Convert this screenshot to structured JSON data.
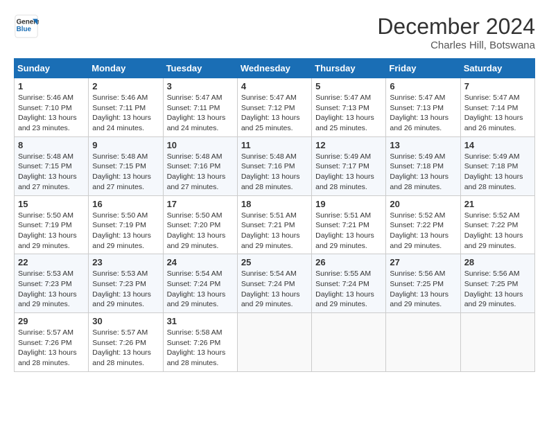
{
  "header": {
    "logo_line1": "General",
    "logo_line2": "Blue",
    "month": "December 2024",
    "location": "Charles Hill, Botswana"
  },
  "days_of_week": [
    "Sunday",
    "Monday",
    "Tuesday",
    "Wednesday",
    "Thursday",
    "Friday",
    "Saturday"
  ],
  "weeks": [
    [
      {
        "day": 1,
        "lines": [
          "Sunrise: 5:46 AM",
          "Sunset: 7:10 PM",
          "Daylight: 13 hours",
          "and 23 minutes."
        ]
      },
      {
        "day": 2,
        "lines": [
          "Sunrise: 5:46 AM",
          "Sunset: 7:11 PM",
          "Daylight: 13 hours",
          "and 24 minutes."
        ]
      },
      {
        "day": 3,
        "lines": [
          "Sunrise: 5:47 AM",
          "Sunset: 7:11 PM",
          "Daylight: 13 hours",
          "and 24 minutes."
        ]
      },
      {
        "day": 4,
        "lines": [
          "Sunrise: 5:47 AM",
          "Sunset: 7:12 PM",
          "Daylight: 13 hours",
          "and 25 minutes."
        ]
      },
      {
        "day": 5,
        "lines": [
          "Sunrise: 5:47 AM",
          "Sunset: 7:13 PM",
          "Daylight: 13 hours",
          "and 25 minutes."
        ]
      },
      {
        "day": 6,
        "lines": [
          "Sunrise: 5:47 AM",
          "Sunset: 7:13 PM",
          "Daylight: 13 hours",
          "and 26 minutes."
        ]
      },
      {
        "day": 7,
        "lines": [
          "Sunrise: 5:47 AM",
          "Sunset: 7:14 PM",
          "Daylight: 13 hours",
          "and 26 minutes."
        ]
      }
    ],
    [
      {
        "day": 8,
        "lines": [
          "Sunrise: 5:48 AM",
          "Sunset: 7:15 PM",
          "Daylight: 13 hours",
          "and 27 minutes."
        ]
      },
      {
        "day": 9,
        "lines": [
          "Sunrise: 5:48 AM",
          "Sunset: 7:15 PM",
          "Daylight: 13 hours",
          "and 27 minutes."
        ]
      },
      {
        "day": 10,
        "lines": [
          "Sunrise: 5:48 AM",
          "Sunset: 7:16 PM",
          "Daylight: 13 hours",
          "and 27 minutes."
        ]
      },
      {
        "day": 11,
        "lines": [
          "Sunrise: 5:48 AM",
          "Sunset: 7:16 PM",
          "Daylight: 13 hours",
          "and 28 minutes."
        ]
      },
      {
        "day": 12,
        "lines": [
          "Sunrise: 5:49 AM",
          "Sunset: 7:17 PM",
          "Daylight: 13 hours",
          "and 28 minutes."
        ]
      },
      {
        "day": 13,
        "lines": [
          "Sunrise: 5:49 AM",
          "Sunset: 7:18 PM",
          "Daylight: 13 hours",
          "and 28 minutes."
        ]
      },
      {
        "day": 14,
        "lines": [
          "Sunrise: 5:49 AM",
          "Sunset: 7:18 PM",
          "Daylight: 13 hours",
          "and 28 minutes."
        ]
      }
    ],
    [
      {
        "day": 15,
        "lines": [
          "Sunrise: 5:50 AM",
          "Sunset: 7:19 PM",
          "Daylight: 13 hours",
          "and 29 minutes."
        ]
      },
      {
        "day": 16,
        "lines": [
          "Sunrise: 5:50 AM",
          "Sunset: 7:19 PM",
          "Daylight: 13 hours",
          "and 29 minutes."
        ]
      },
      {
        "day": 17,
        "lines": [
          "Sunrise: 5:50 AM",
          "Sunset: 7:20 PM",
          "Daylight: 13 hours",
          "and 29 minutes."
        ]
      },
      {
        "day": 18,
        "lines": [
          "Sunrise: 5:51 AM",
          "Sunset: 7:21 PM",
          "Daylight: 13 hours",
          "and 29 minutes."
        ]
      },
      {
        "day": 19,
        "lines": [
          "Sunrise: 5:51 AM",
          "Sunset: 7:21 PM",
          "Daylight: 13 hours",
          "and 29 minutes."
        ]
      },
      {
        "day": 20,
        "lines": [
          "Sunrise: 5:52 AM",
          "Sunset: 7:22 PM",
          "Daylight: 13 hours",
          "and 29 minutes."
        ]
      },
      {
        "day": 21,
        "lines": [
          "Sunrise: 5:52 AM",
          "Sunset: 7:22 PM",
          "Daylight: 13 hours",
          "and 29 minutes."
        ]
      }
    ],
    [
      {
        "day": 22,
        "lines": [
          "Sunrise: 5:53 AM",
          "Sunset: 7:23 PM",
          "Daylight: 13 hours",
          "and 29 minutes."
        ]
      },
      {
        "day": 23,
        "lines": [
          "Sunrise: 5:53 AM",
          "Sunset: 7:23 PM",
          "Daylight: 13 hours",
          "and 29 minutes."
        ]
      },
      {
        "day": 24,
        "lines": [
          "Sunrise: 5:54 AM",
          "Sunset: 7:24 PM",
          "Daylight: 13 hours",
          "and 29 minutes."
        ]
      },
      {
        "day": 25,
        "lines": [
          "Sunrise: 5:54 AM",
          "Sunset: 7:24 PM",
          "Daylight: 13 hours",
          "and 29 minutes."
        ]
      },
      {
        "day": 26,
        "lines": [
          "Sunrise: 5:55 AM",
          "Sunset: 7:24 PM",
          "Daylight: 13 hours",
          "and 29 minutes."
        ]
      },
      {
        "day": 27,
        "lines": [
          "Sunrise: 5:56 AM",
          "Sunset: 7:25 PM",
          "Daylight: 13 hours",
          "and 29 minutes."
        ]
      },
      {
        "day": 28,
        "lines": [
          "Sunrise: 5:56 AM",
          "Sunset: 7:25 PM",
          "Daylight: 13 hours",
          "and 29 minutes."
        ]
      }
    ],
    [
      {
        "day": 29,
        "lines": [
          "Sunrise: 5:57 AM",
          "Sunset: 7:26 PM",
          "Daylight: 13 hours",
          "and 28 minutes."
        ]
      },
      {
        "day": 30,
        "lines": [
          "Sunrise: 5:57 AM",
          "Sunset: 7:26 PM",
          "Daylight: 13 hours",
          "and 28 minutes."
        ]
      },
      {
        "day": 31,
        "lines": [
          "Sunrise: 5:58 AM",
          "Sunset: 7:26 PM",
          "Daylight: 13 hours",
          "and 28 minutes."
        ]
      },
      null,
      null,
      null,
      null
    ]
  ]
}
